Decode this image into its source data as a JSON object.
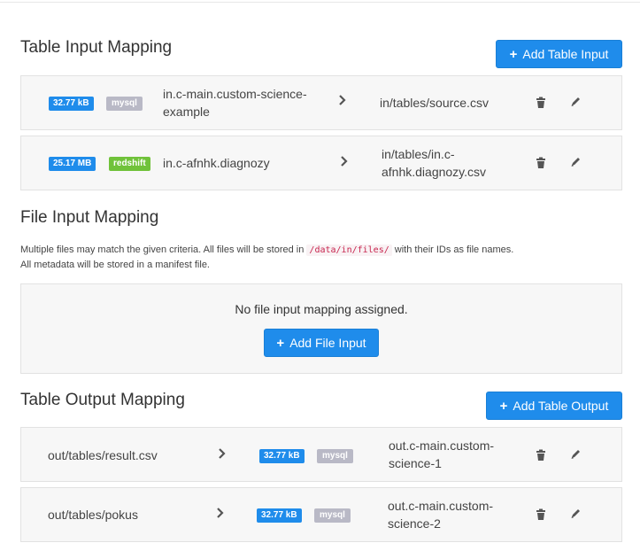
{
  "table_input": {
    "title": "Table Input Mapping",
    "add_label": "Add Table Input",
    "rows": [
      {
        "size": "32.77 kB",
        "backend": "mysql",
        "source_line1": "in.c-main.custom-science-",
        "source_line2": "example",
        "destination_line1": "in/tables/source.csv",
        "destination_line2": ""
      },
      {
        "size": "25.17 MB",
        "backend": "redshift",
        "source_line1": "in.c-afnhk.diagnozy",
        "source_line2": "",
        "destination_line1": "in/tables/in.c-",
        "destination_line2": "afnhk.diagnozy.csv"
      }
    ]
  },
  "file_input": {
    "title": "File Input Mapping",
    "help_before": "Multiple files may match the given criteria. All files will be stored in",
    "help_code": "/data/in/files/",
    "help_after": "with their IDs as file names.",
    "help_line2": "All metadata will be stored in a manifest file.",
    "empty_text": "No file input mapping assigned.",
    "add_label": "Add File Input"
  },
  "table_output": {
    "title": "Table Output Mapping",
    "add_label": "Add Table Output",
    "rows": [
      {
        "source": "out/tables/result.csv",
        "size": "32.77 kB",
        "backend": "mysql",
        "destination_line1": "out.c-main.custom-",
        "destination_line2": "science-1"
      },
      {
        "source": "out/tables/pokus",
        "size": "32.77 kB",
        "backend": "mysql",
        "destination_line1": "out.c-main.custom-",
        "destination_line2": "science-2"
      }
    ]
  },
  "icons": {
    "add": "plus-icon",
    "arrow": "chevron-right-icon",
    "delete": "trash-icon",
    "edit": "pencil-icon"
  },
  "colors": {
    "primary": "#1f8ceb",
    "mysql_badge": "#b9b9c6",
    "redshift_badge": "#70c23a"
  }
}
